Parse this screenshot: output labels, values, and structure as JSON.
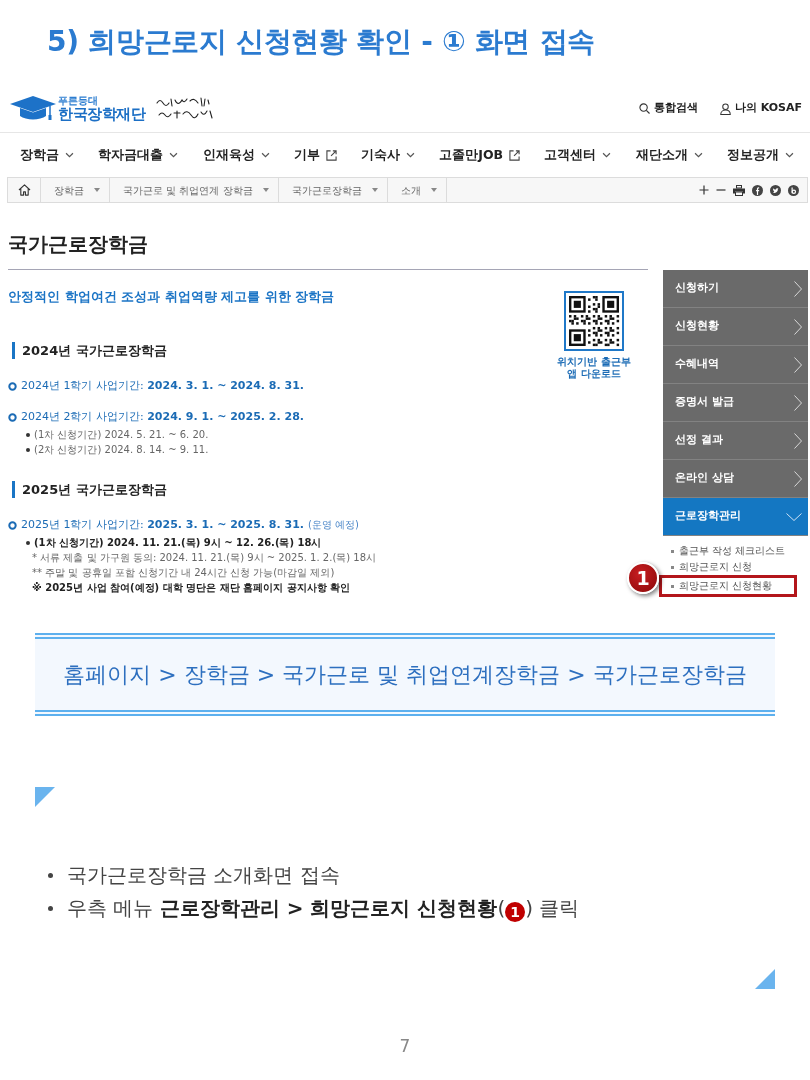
{
  "slide_title": "5) 희망근로지 신청현황 확인 - ① 화면 접속",
  "screenshot": {
    "logo": {
      "small_text": "푸른등대",
      "name": "한국장학재단"
    },
    "utility_links": [
      {
        "label": "통합검색",
        "kind": "search"
      },
      {
        "label": "나의 KOSAF",
        "kind": "user"
      }
    ],
    "main_nav": [
      {
        "label": "장학금",
        "kind": "dropdown"
      },
      {
        "label": "학자금대출",
        "kind": "dropdown"
      },
      {
        "label": "인재육성",
        "kind": "dropdown"
      },
      {
        "label": "기부",
        "kind": "external"
      },
      {
        "label": "기숙사",
        "kind": "dropdown"
      },
      {
        "label": "고졸만JOB",
        "kind": "external"
      },
      {
        "label": "고객센터",
        "kind": "dropdown"
      },
      {
        "label": "재단소개",
        "kind": "dropdown"
      },
      {
        "label": "정보공개",
        "kind": "dropdown"
      }
    ],
    "breadcrumb": [
      "장학금",
      "국가근로 및 취업연계 장학금",
      "국가근로장학금",
      "소개"
    ],
    "page_title": "국가근로장학금",
    "intro": "안정적인 학업여건 조성과 취업역량 제고를 위한 장학금",
    "qr_caption": [
      "위치기반 출근부",
      "앱 다운로드"
    ],
    "sections": [
      {
        "heading": "2024년 국가근로장학금",
        "periods": [
          {
            "text": "2024년 1학기 사업기간: **2024. 3. 1. ~ 2024. 8. 31.**"
          },
          {
            "text": "2024년 2학기 사업기간: **2024. 9. 1. ~ 2025. 2. 28.**",
            "items": [
              {
                "kind": "bullet",
                "text": "(1차 신청기간) 2024. 5. 21. ~ 6. 20."
              },
              {
                "kind": "bullet",
                "text": "(2차 신청기간) 2024. 8. 14. ~ 9. 11."
              }
            ]
          }
        ]
      },
      {
        "heading": "2025년 국가근로장학금",
        "periods": [
          {
            "text": "2025년 1학기 사업기간: **2025. 3. 1. ~ 2025. 8. 31.**",
            "note": "(운영 예정)",
            "items": [
              {
                "kind": "bullet",
                "text": "**(1차 신청기간) 2024. 11. 21.(목) 9시 ~ 12. 26.(목) 18시**"
              },
              {
                "kind": "note",
                "text": "* 서류 제출 및 가구원 동의: 2024. 11. 21.(목) 9시 ~ 2025. 1. 2.(목) 18시"
              },
              {
                "kind": "note",
                "text": "** 주말 및 공휴일 포함 신청기간 내 24시간 신청 가능(마감일 제외)"
              },
              {
                "kind": "note",
                "text": "**※ 2025년 사업 참여(예정) 대학 명단은 재단 홈페이지 공지사항 확인**"
              }
            ]
          }
        ]
      }
    ],
    "side_menu": {
      "items": [
        {
          "label": "신청하기",
          "expanded": false
        },
        {
          "label": "신청현황",
          "expanded": false
        },
        {
          "label": "수혜내역",
          "expanded": false
        },
        {
          "label": "증명서 발급",
          "expanded": false
        },
        {
          "label": "선정 결과",
          "expanded": false
        },
        {
          "label": "온라인 상담",
          "expanded": false
        },
        {
          "label": "근로장학관리",
          "expanded": true,
          "children": [
            {
              "label": "출근부 작성 체크리스트",
              "highlighted": false
            },
            {
              "label": "희망근로지 신청",
              "highlighted": false
            },
            {
              "label": "희망근로지 신청현황",
              "highlighted": true
            }
          ]
        }
      ],
      "callout": "1"
    }
  },
  "path_banner": "홈페이지 > 장학금 > 국가근로 및 취업연계장학금 > 국가근로장학금",
  "instructions": [
    {
      "text": "국가근로장학금 소개화면 접속"
    },
    {
      "text": "우측 메뉴 **근로장학관리 > 희망근로지 신청현황**(",
      "marker": "1",
      "text_after": ") 클릭"
    }
  ],
  "page_number": "7"
}
